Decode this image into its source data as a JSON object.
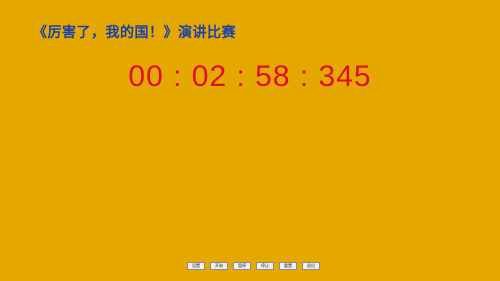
{
  "header": {
    "title": "《厉害了，我的国！》演讲比赛"
  },
  "timer": {
    "value": "00 : 02 : 58 : 345"
  },
  "controls": {
    "buttons": [
      {
        "label": "设置"
      },
      {
        "label": "开始"
      },
      {
        "label": "暂停"
      },
      {
        "label": "停止"
      },
      {
        "label": "重置"
      },
      {
        "label": "退出"
      }
    ]
  },
  "colors": {
    "background": "#e5a800",
    "title": "#1d40a8",
    "timer": "#e0102a"
  }
}
